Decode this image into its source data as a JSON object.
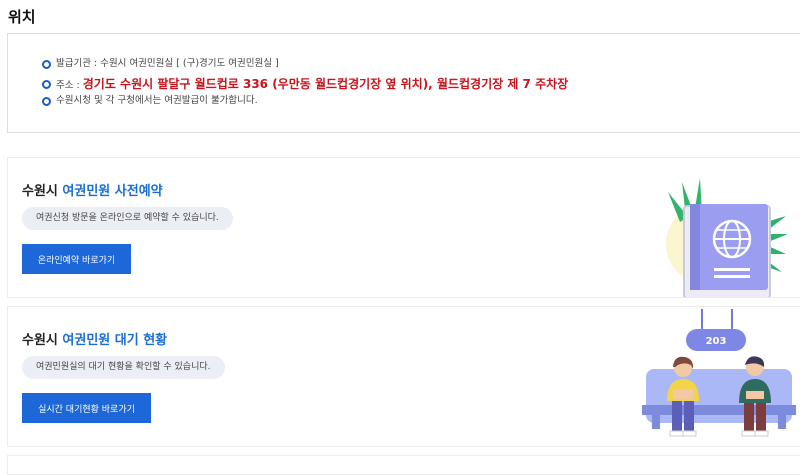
{
  "page": {
    "title": "위치"
  },
  "location": {
    "items": [
      {
        "text": "발급기관 : 수원시 여권민원실 [ (구)경기도 여권민원실 ]"
      },
      {
        "label": "주소 : ",
        "address": "경기도 수원시 팔달구 월드컵로 336 (우만동 월드컵경기장 옆 위치),  월드컵경기장 제 7 주차장"
      },
      {
        "text": "수원시청 및 각 구청에서는 여권발급이 불가합니다."
      }
    ]
  },
  "cards": [
    {
      "title_prefix": "수원시 ",
      "title_highlight": "여권민원 사전예약",
      "description": "여권신청 방문을 온라인으로 예약할 수 있습니다.",
      "button_label": "온라인예약 바로가기"
    },
    {
      "title_prefix": "수원시 ",
      "title_highlight": "여권민원 대기 현황",
      "description": "여권민원실의 대기 현황을 확인할 수 있습니다.",
      "button_label": "실시간 대기현황 바로가기",
      "sign_number": "203"
    }
  ],
  "colors": {
    "accent": "#1d67d8",
    "highlight": "#1a6dd4",
    "address": "#c8141c",
    "pill": "#eceef6",
    "bullet": "#1a5bc4"
  },
  "icons": [
    "passport-illustration",
    "waiting-room-illustration"
  ]
}
